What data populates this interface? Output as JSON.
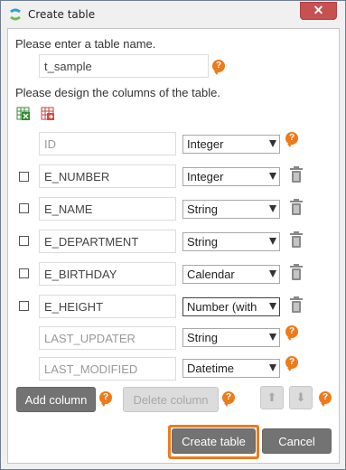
{
  "window": {
    "title": "Create table",
    "close_label": "✕"
  },
  "table_name": {
    "prompt": "Please enter a table name.",
    "value": "t_sample"
  },
  "columns_prompt": "Please design the columns of the table.",
  "columns": [
    {
      "name": "ID",
      "type": "Integer"
    },
    {
      "name": "E_NUMBER",
      "type": "Integer"
    },
    {
      "name": "E_NAME",
      "type": "String"
    },
    {
      "name": "E_DEPARTMENT",
      "type": "String"
    },
    {
      "name": "E_BIRTHDAY",
      "type": "Calendar"
    },
    {
      "name": "E_HEIGHT",
      "type": "Number (with"
    },
    {
      "name": "LAST_UPDATER",
      "type": "String"
    },
    {
      "name": "LAST_MODIFIED",
      "type": "Datetime"
    }
  ],
  "buttons": {
    "add_column": "Add column",
    "delete_column": "Delete column",
    "move_up": "⬆",
    "move_down": "⬇",
    "create_table": "Create table",
    "cancel": "Cancel"
  },
  "help_glyph": "?",
  "colors": {
    "accent": "#ee7a1a",
    "close": "#c75050"
  }
}
